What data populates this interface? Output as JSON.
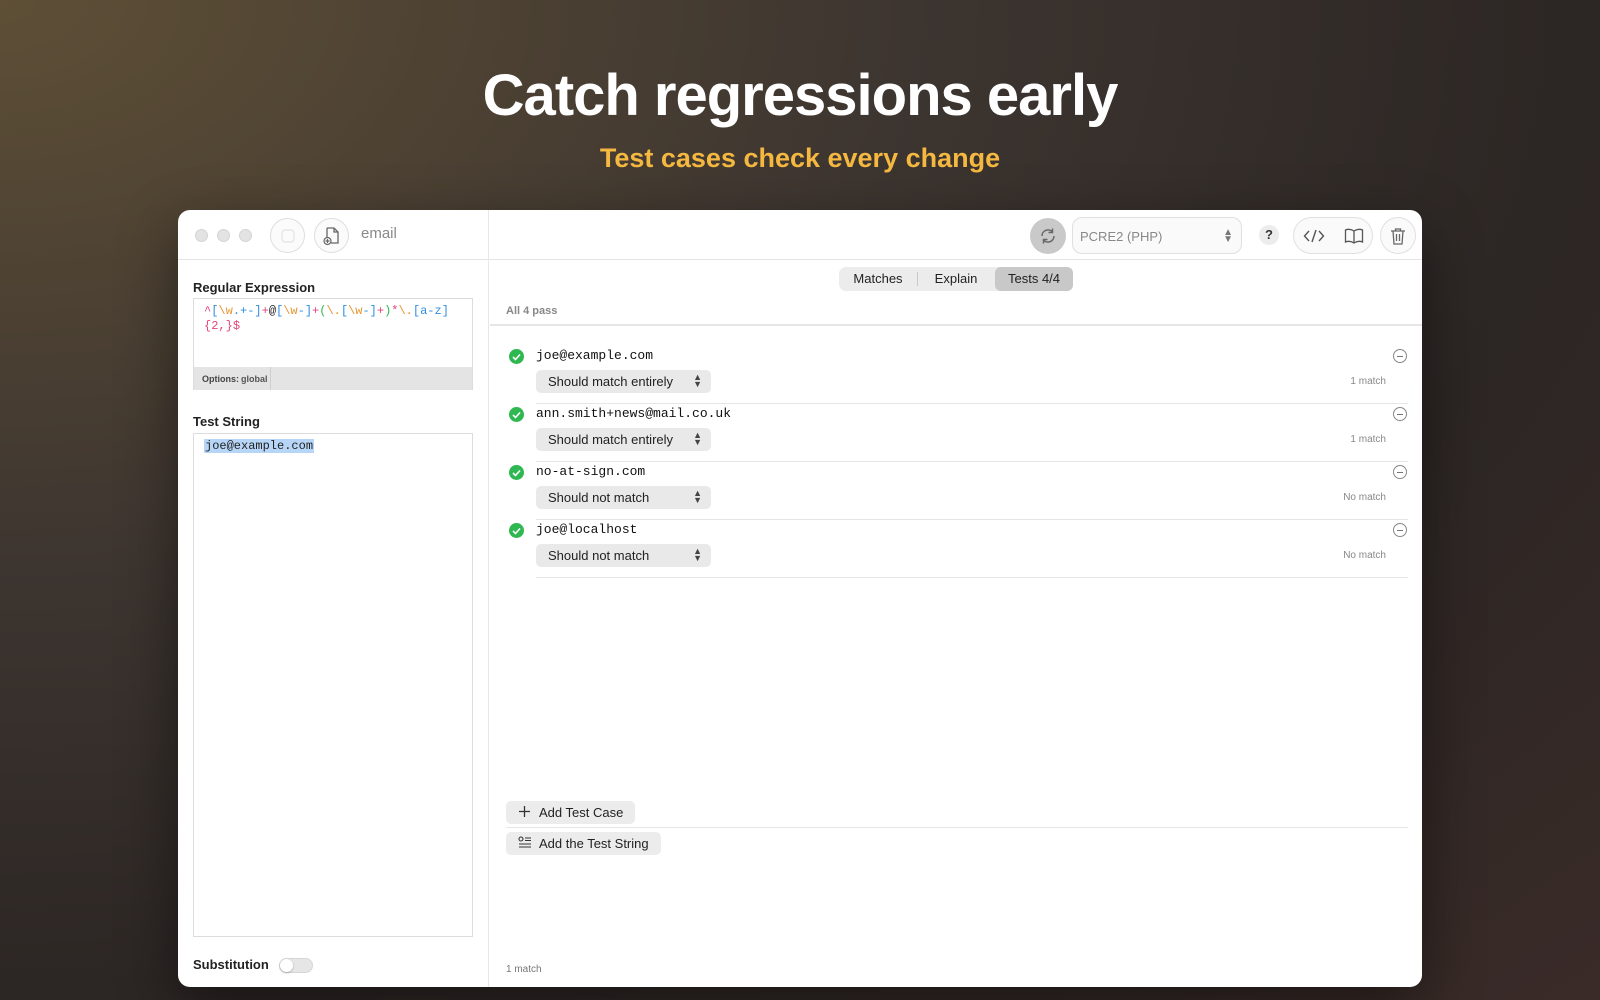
{
  "hero": {
    "title": "Catch regressions early",
    "subtitle": "Test cases check every change"
  },
  "toolbar": {
    "document_title": "email",
    "flavor": "PCRE2 (PHP)",
    "help_label": "?"
  },
  "regex_panel": {
    "heading": "Regular Expression",
    "pattern_tokens": [
      {
        "text": "^",
        "color": "#e0457b"
      },
      {
        "text": "[",
        "color": "#2f8fe0"
      },
      {
        "text": "\\w",
        "color": "#e8952e"
      },
      {
        "text": ".+-",
        "color": "#2f8fe0"
      },
      {
        "text": "]",
        "color": "#2f8fe0"
      },
      {
        "text": "+",
        "color": "#e0457b"
      },
      {
        "text": "@",
        "color": "#222222"
      },
      {
        "text": "[",
        "color": "#2f8fe0"
      },
      {
        "text": "\\w",
        "color": "#e8952e"
      },
      {
        "text": "-",
        "color": "#2f8fe0"
      },
      {
        "text": "]",
        "color": "#2f8fe0"
      },
      {
        "text": "+",
        "color": "#e0457b"
      },
      {
        "text": "(",
        "color": "#2fb851"
      },
      {
        "text": "\\.",
        "color": "#e8952e"
      },
      {
        "text": "[",
        "color": "#2f8fe0"
      },
      {
        "text": "\\w",
        "color": "#e8952e"
      },
      {
        "text": "-",
        "color": "#2f8fe0"
      },
      {
        "text": "]",
        "color": "#2f8fe0"
      },
      {
        "text": "+",
        "color": "#e0457b"
      },
      {
        "text": ")",
        "color": "#2fb851"
      },
      {
        "text": "*",
        "color": "#e0457b"
      },
      {
        "text": "\\.",
        "color": "#e8952e"
      },
      {
        "text": "[a-z]",
        "color": "#2f8fe0"
      },
      {
        "text": "{2,}",
        "color": "#e0457b"
      },
      {
        "text": "$",
        "color": "#e0457b"
      }
    ],
    "options_label": "Options:",
    "options_value": "global"
  },
  "test_string_panel": {
    "heading": "Test String",
    "value": "joe@example.com",
    "substitution_label": "Substitution",
    "substitution_enabled": false
  },
  "tabs": [
    {
      "label": "Matches",
      "active": false
    },
    {
      "label": "Explain",
      "active": false
    },
    {
      "label": "Tests 4/4",
      "active": true
    }
  ],
  "tests": {
    "summary": "All 4 pass",
    "cases": [
      {
        "input": "joe@example.com",
        "expectation": "Should match entirely",
        "result": "1 match",
        "passed": true
      },
      {
        "input": "ann.smith+news@mail.co.uk",
        "expectation": "Should match entirely",
        "result": "1 match",
        "passed": true
      },
      {
        "input": "no-at-sign.com",
        "expectation": "Should not match",
        "result": "No match",
        "passed": true
      },
      {
        "input": "joe@localhost",
        "expectation": "Should not match",
        "result": "No match",
        "passed": true
      }
    ],
    "add_test_case_label": "Add Test Case",
    "add_test_string_label": "Add the Test String"
  },
  "status": {
    "footer": "1 match"
  },
  "colors": {
    "accent_yellow": "#f5b840",
    "pass_green": "#2fb851"
  }
}
